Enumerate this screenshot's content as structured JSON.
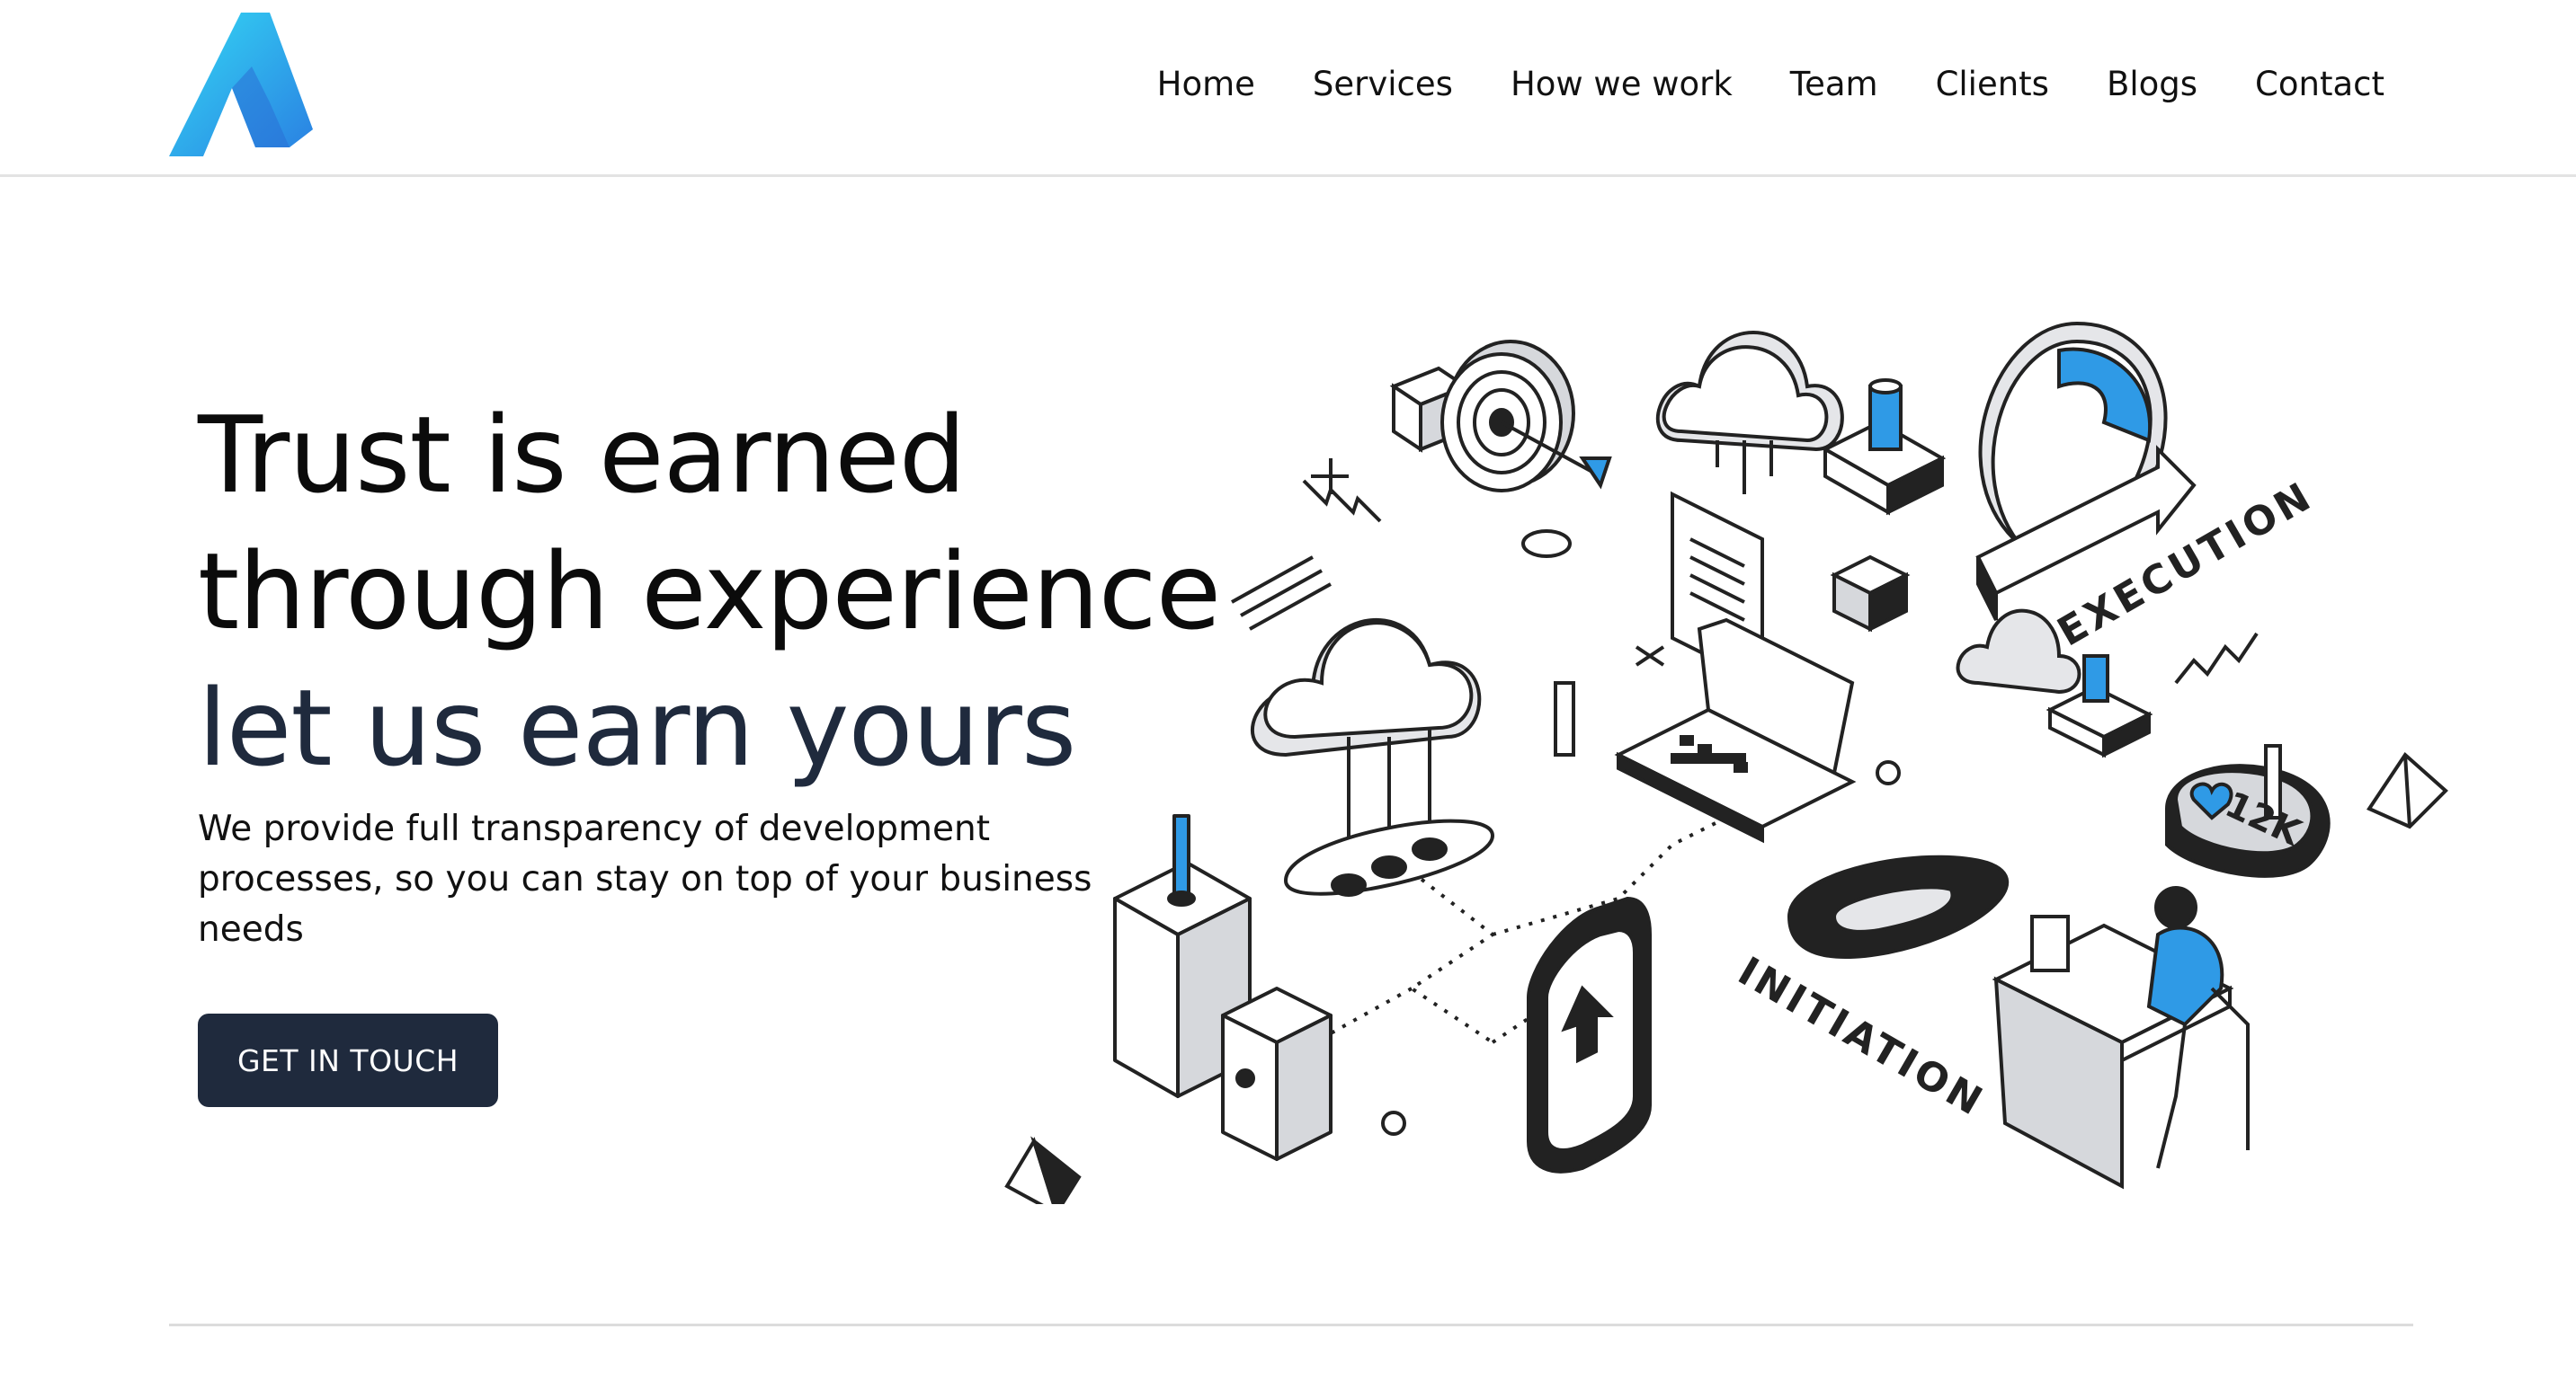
{
  "nav": {
    "items": [
      "Home",
      "Services",
      "How we work",
      "Team",
      "Clients",
      "Blogs",
      "Contact"
    ]
  },
  "hero": {
    "line1": "Trust is earned",
    "line2": "through experience",
    "line3": "let us earn yours",
    "lead": "We provide full transparency of development processes, so you can stay on top of your business needs",
    "cta": "GET IN TOUCH"
  },
  "illustration": {
    "execution_label": "EXECUTION",
    "initiation_label": "INITIATION",
    "likes_label": "12K"
  },
  "colors": {
    "primary_dark": "#1f2a3d",
    "accent_blue": "#2f9ae6",
    "logo_gradient_start": "#32d6f2",
    "logo_gradient_end": "#2a7de1"
  }
}
